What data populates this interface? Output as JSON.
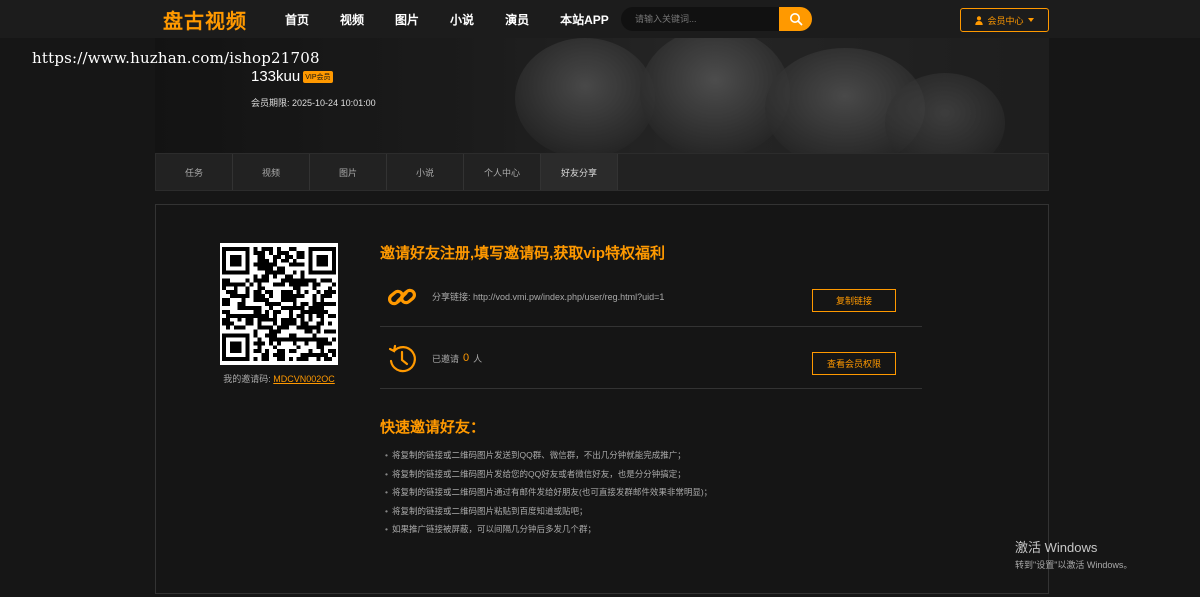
{
  "header": {
    "logo": "盘古视频",
    "nav": [
      "首页",
      "视频",
      "图片",
      "小说",
      "演员",
      "本站APP"
    ],
    "search_placeholder": "请输入关键词...",
    "member_center": "会员中心"
  },
  "watermark": "https://www.huzhan.com/ishop21708",
  "profile": {
    "username": "133kuu",
    "vip_badge": "VIP会员",
    "expiry_label": "会员期限:",
    "expiry_value": "2025-10-24 10:01:00"
  },
  "tabs": [
    "任务",
    "视频",
    "图片",
    "小说",
    "个人中心",
    "好友分享"
  ],
  "active_tab": "好友分享",
  "invite": {
    "code_label": "我的邀请码:",
    "code": "MDCVN002OC",
    "headline": "邀请好友注册,填写邀请码,获取vip特权福利",
    "share_link_text": "分享链接: http://vod.vmi.pw/index.php/user/reg.html?uid=1",
    "copy_button": "复制链接",
    "invited_label": "已邀请",
    "invited_count": "0",
    "invited_unit": "人",
    "view_rights_button": "查看会员权限"
  },
  "quick": {
    "title": "快速邀请好友：",
    "tips": [
      "将复制的链接或二维码图片发送到QQ群、微信群，不出几分钟就能完成推广；",
      "将复制的链接或二维码图片发给您的QQ好友或者微信好友，也是分分钟搞定；",
      "将复制的链接或二维码图片通过有邮件发给好朋友(也可直接发群邮件效果非常明显)；",
      "将复制的链接或二维码图片粘贴到百度知道或贴吧；",
      "如果推广链接被屏蔽，可以间隔几分钟后多发几个群；"
    ]
  },
  "windows_overlay": {
    "title": "激活 Windows",
    "subtitle": "转到\"设置\"以激活 Windows。"
  },
  "colors": {
    "accent": "#ff9900",
    "background": "#161616"
  }
}
